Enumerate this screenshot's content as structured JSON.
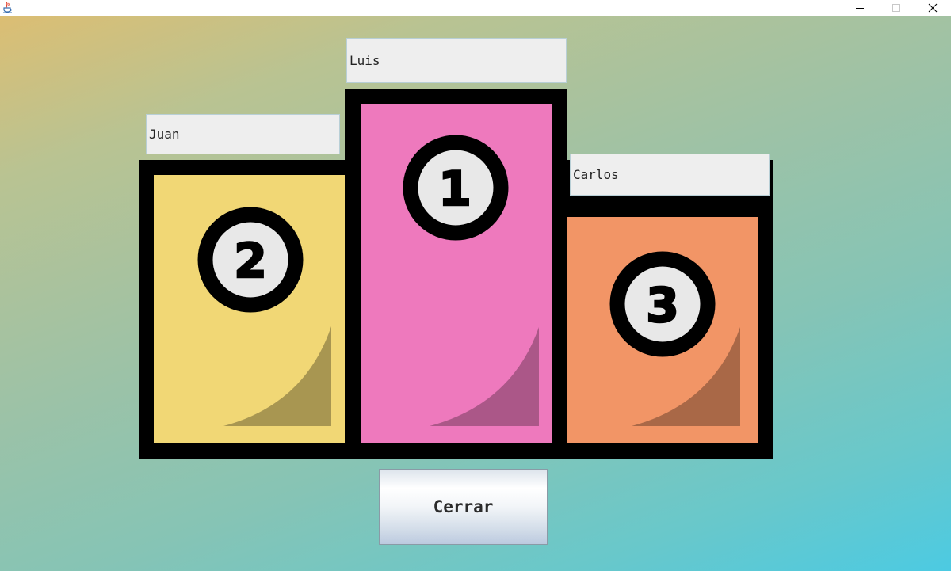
{
  "window": {
    "icon": "java-cup-icon",
    "controls": [
      "minimize-icon",
      "maximize-icon",
      "close-icon"
    ]
  },
  "podium": {
    "first_place": {
      "rank": "1",
      "name": "Luis",
      "color": "#ee79bd"
    },
    "second_place": {
      "rank": "2",
      "name": "Juan",
      "color": "#f1d775"
    },
    "third_place": {
      "rank": "3",
      "name": "Carlos",
      "color": "#f29566"
    }
  },
  "actions": {
    "close_label": "Cerrar"
  },
  "colors": {
    "outline": "#000000",
    "badge_fill": "#e8e8e8",
    "field_bg": "#eeeeee"
  }
}
